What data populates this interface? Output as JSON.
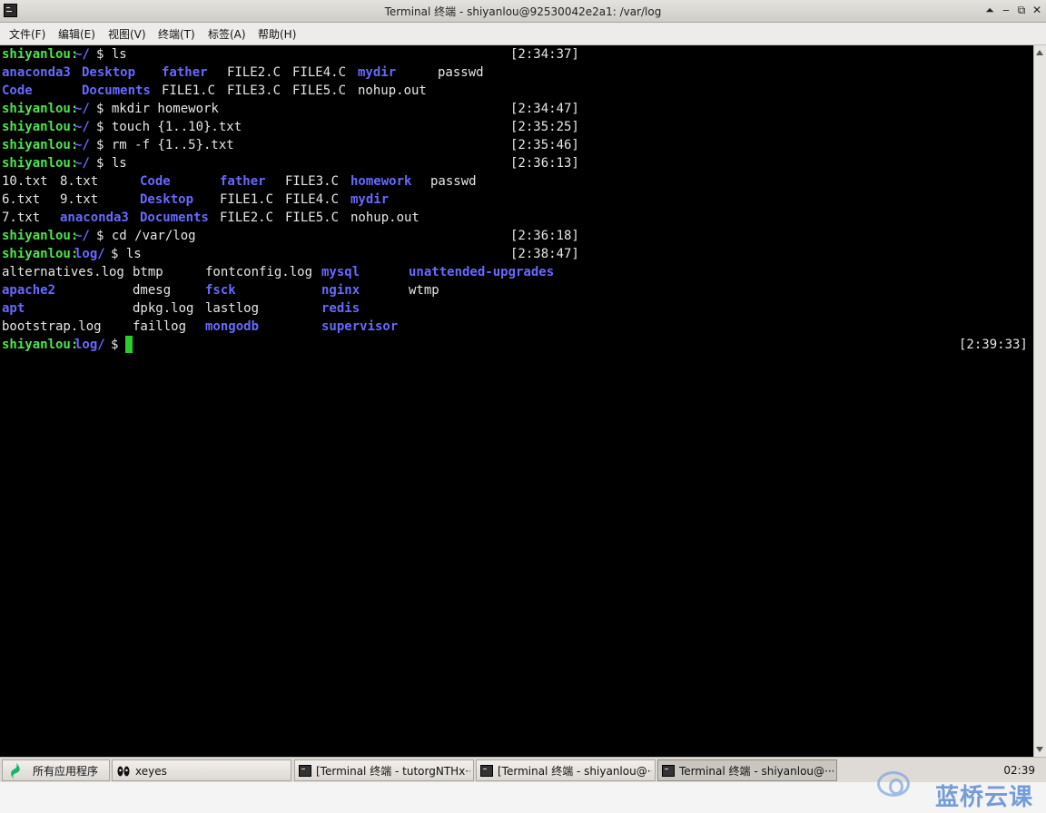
{
  "window": {
    "title": "Terminal 终端 - shiyanlou@92530042e2a1: /var/log",
    "controls": {
      "shade": "⏶",
      "minimize": "‒",
      "maximize": "⧉",
      "close": "✕"
    }
  },
  "menu": {
    "items": [
      "文件(F)",
      "编辑(E)",
      "视图(V)",
      "终端(T)",
      "标签(A)",
      "帮助(H)"
    ]
  },
  "terminal": {
    "prompt_user": "shiyanlou",
    "lines": [
      {
        "segs": [
          [
            "shiyanlou:",
            "g",
            0
          ],
          [
            "~/",
            "b",
            80
          ],
          [
            "$ ls",
            "w",
            104
          ]
        ],
        "ts": "[2:34:37]"
      },
      {
        "segs": [
          [
            "anaconda3",
            "b",
            0
          ],
          [
            "Desktop",
            "b",
            88
          ],
          [
            "father",
            "b",
            176
          ],
          [
            "FILE2.C",
            "w",
            248
          ],
          [
            "FILE4.C",
            "w",
            320
          ],
          [
            "mydir",
            "b",
            392
          ],
          [
            "passwd",
            "w",
            480
          ]
        ]
      },
      {
        "segs": [
          [
            "Code",
            "b",
            0
          ],
          [
            "Documents",
            "b",
            88
          ],
          [
            "FILE1.C",
            "w",
            176
          ],
          [
            "FILE3.C",
            "w",
            248
          ],
          [
            "FILE5.C",
            "w",
            320
          ],
          [
            "nohup.out",
            "w",
            392
          ]
        ]
      },
      {
        "segs": [
          [
            "shiyanlou:",
            "g",
            0
          ],
          [
            "~/",
            "b",
            80
          ],
          [
            "$ mkdir homework",
            "w",
            104
          ]
        ],
        "ts": "[2:34:47]"
      },
      {
        "segs": [
          [
            "shiyanlou:",
            "g",
            0
          ],
          [
            "~/",
            "b",
            80
          ],
          [
            "$ touch {1..10}.txt",
            "w",
            104
          ]
        ],
        "ts": "[2:35:25]"
      },
      {
        "segs": [
          [
            "shiyanlou:",
            "g",
            0
          ],
          [
            "~/",
            "b",
            80
          ],
          [
            "$ rm -f {1..5}.txt",
            "w",
            104
          ]
        ],
        "ts": "[2:35:46]"
      },
      {
        "segs": [
          [
            "shiyanlou:",
            "g",
            0
          ],
          [
            "~/",
            "b",
            80
          ],
          [
            "$ ls",
            "w",
            104
          ]
        ],
        "ts": "[2:36:13]"
      },
      {
        "segs": [
          [
            "10.txt",
            "w",
            0
          ],
          [
            "8.txt",
            "w",
            64
          ],
          [
            "Code",
            "b",
            152
          ],
          [
            "father",
            "b",
            240
          ],
          [
            "FILE3.C",
            "w",
            312
          ],
          [
            "homework",
            "b",
            384
          ],
          [
            "passwd",
            "w",
            472
          ]
        ]
      },
      {
        "segs": [
          [
            "6.txt",
            "w",
            0
          ],
          [
            "9.txt",
            "w",
            64
          ],
          [
            "Desktop",
            "b",
            152
          ],
          [
            "FILE1.C",
            "w",
            240
          ],
          [
            "FILE4.C",
            "w",
            312
          ],
          [
            "mydir",
            "b",
            384
          ]
        ]
      },
      {
        "segs": [
          [
            "7.txt",
            "w",
            0
          ],
          [
            "anaconda3",
            "b",
            64
          ],
          [
            "Documents",
            "b",
            152
          ],
          [
            "FILE2.C",
            "w",
            240
          ],
          [
            "FILE5.C",
            "w",
            312
          ],
          [
            "nohup.out",
            "w",
            384
          ]
        ]
      },
      {
        "segs": [
          [
            "shiyanlou:",
            "g",
            0
          ],
          [
            "~/",
            "b",
            80
          ],
          [
            "$ cd /var/log",
            "w",
            104
          ]
        ],
        "ts": "[2:36:18]"
      },
      {
        "segs": [
          [
            "shiyanlou:",
            "g",
            0
          ],
          [
            "log/",
            "b",
            80
          ],
          [
            "$ ls",
            "w",
            120
          ]
        ],
        "ts": "[2:38:47]"
      },
      {
        "segs": [
          [
            "alternatives.log",
            "w",
            0
          ],
          [
            "btmp",
            "w",
            144
          ],
          [
            "fontconfig.log",
            "w",
            224
          ],
          [
            "mysql",
            "b",
            352
          ],
          [
            "unattended-upgrades",
            "b",
            448
          ]
        ]
      },
      {
        "segs": [
          [
            "apache2",
            "b",
            0
          ],
          [
            "dmesg",
            "w",
            144
          ],
          [
            "fsck",
            "b",
            224
          ],
          [
            "nginx",
            "b",
            352
          ],
          [
            "wtmp",
            "w",
            448
          ]
        ]
      },
      {
        "segs": [
          [
            "apt",
            "b",
            0
          ],
          [
            "dpkg.log",
            "w",
            144
          ],
          [
            "lastlog",
            "w",
            224
          ],
          [
            "redis",
            "b",
            352
          ]
        ]
      },
      {
        "segs": [
          [
            "bootstrap.log",
            "w",
            0
          ],
          [
            "faillog",
            "w",
            144
          ],
          [
            "mongodb",
            "b",
            224
          ],
          [
            "supervisor",
            "b",
            352
          ]
        ]
      },
      {
        "segs": [
          [
            "shiyanlou:",
            "g",
            0
          ],
          [
            "log/",
            "b",
            80
          ],
          [
            "$ ",
            "w",
            120
          ]
        ],
        "ts": "[2:39:33]",
        "cursor": true
      }
    ]
  },
  "taskbar": {
    "start_label": "所有应用程序",
    "xeyes_label": "xeyes",
    "windows": [
      {
        "label": "[Terminal 终端 - tutorgNTHx···",
        "active": false
      },
      {
        "label": "[Terminal 终端 - shiyanlou@···",
        "active": false
      },
      {
        "label": "Terminal 终端 - shiyanlou@···",
        "active": true
      }
    ],
    "clock": "02:39"
  },
  "watermark": {
    "text": "蓝桥云课"
  },
  "colors": {
    "prompt_green": "#4ee44e",
    "dir_blue": "#6868ff",
    "cursor_green": "#2ccc2c",
    "terminal_bg": "#000000"
  }
}
